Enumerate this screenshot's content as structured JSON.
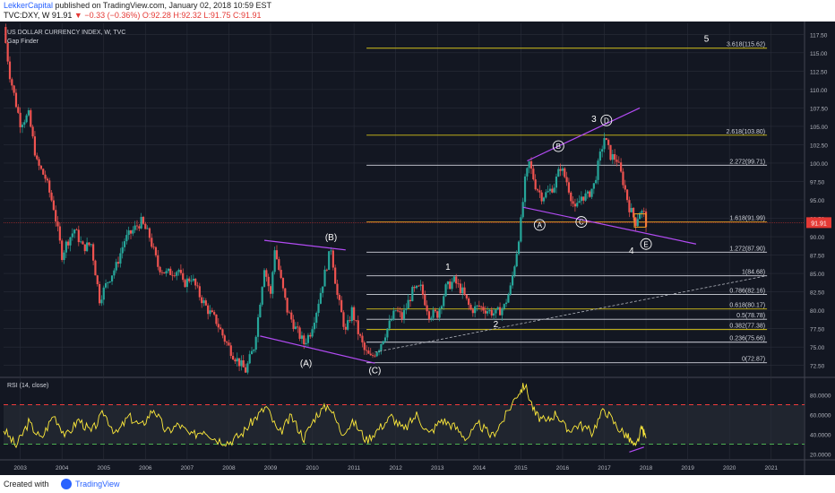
{
  "header": {
    "publisher": "LekkerCapital",
    "published_text": "published on TradingView.com, January 02, 2018 10:59 EST",
    "symbol_line_prefix": "TVC:DXY, W",
    "symbol_line_last": "91.91",
    "symbol_line_change": "▼ −0.33 (−0.36%)",
    "symbol_line_ohlc": "O:92.28 H:92.32 L:91.75 C:91.91"
  },
  "footer": {
    "created_with": "Created with",
    "brand": "TradingView"
  },
  "colors": {
    "background": "#131722",
    "grid": "#2a2e39",
    "axis_text": "#b2b5be",
    "up": "#26a69a",
    "down": "#ef5350",
    "fib_white": "#d1d4dc",
    "fib_yellow": "#d4c21a",
    "fib_orange": "#f5a623",
    "trendline": "#b24bf3",
    "rsi_line": "#ffeb3b",
    "rsi_over": "#ef3b3b",
    "rsi_under": "#4caf50",
    "price_line": "#e53935"
  },
  "chart_data": [
    {
      "type": "candlestick",
      "title": "US DOLLAR CURRENCY INDEX, W, TVC",
      "indicator": "Gap Finder",
      "x_tick_labels": [
        "2003",
        "2004",
        "2005",
        "2006",
        "2007",
        "2008",
        "2009",
        "2010",
        "2011",
        "2012",
        "2013",
        "2014",
        "2015",
        "2016",
        "2017",
        "2018",
        "2019",
        "2020",
        "2021"
      ],
      "xlim": [
        2002.6,
        2021.8
      ],
      "ylim": [
        71.0,
        119.0
      ],
      "y_tick_labels": [
        "117.50",
        "115.00",
        "112.50",
        "110.00",
        "107.50",
        "105.00",
        "102.50",
        "100.00",
        "97.50",
        "95.00",
        "92.50",
        "90.00",
        "87.50",
        "85.00",
        "82.50",
        "80.00",
        "77.50",
        "75.00",
        "72.50"
      ],
      "last_price_label": "91.91",
      "last_price": 91.91,
      "price_path": [
        [
          2002.6,
          118.5
        ],
        [
          2002.75,
          112
        ],
        [
          2002.9,
          108
        ],
        [
          2003.0,
          105.5
        ],
        [
          2003.2,
          106.5
        ],
        [
          2003.4,
          100
        ],
        [
          2003.6,
          98
        ],
        [
          2003.8,
          94
        ],
        [
          2004.0,
          87.5
        ],
        [
          2004.1,
          89
        ],
        [
          2004.3,
          91
        ],
        [
          2004.5,
          88.5
        ],
        [
          2004.7,
          89
        ],
        [
          2004.9,
          81.5
        ],
        [
          2005.1,
          84
        ],
        [
          2005.3,
          86
        ],
        [
          2005.5,
          89.5
        ],
        [
          2005.8,
          91.5
        ],
        [
          2005.9,
          92
        ],
        [
          2006.1,
          90
        ],
        [
          2006.3,
          86
        ],
        [
          2006.5,
          85
        ],
        [
          2006.8,
          85.5
        ],
        [
          2006.9,
          83.5
        ],
        [
          2007.1,
          84.5
        ],
        [
          2007.3,
          82
        ],
        [
          2007.5,
          80
        ],
        [
          2007.7,
          78.5
        ],
        [
          2007.9,
          76
        ],
        [
          2008.1,
          74
        ],
        [
          2008.3,
          72.5
        ],
        [
          2008.4,
          71.8
        ],
        [
          2008.6,
          75
        ],
        [
          2008.7,
          79
        ],
        [
          2008.85,
          86
        ],
        [
          2009.0,
          82
        ],
        [
          2009.1,
          88.5
        ],
        [
          2009.25,
          84
        ],
        [
          2009.4,
          80
        ],
        [
          2009.6,
          77.5
        ],
        [
          2009.8,
          75.5
        ],
        [
          2009.95,
          77
        ],
        [
          2010.1,
          80
        ],
        [
          2010.3,
          85
        ],
        [
          2010.45,
          88.5
        ],
        [
          2010.6,
          82
        ],
        [
          2010.8,
          77
        ],
        [
          2010.95,
          80
        ],
        [
          2011.1,
          77
        ],
        [
          2011.25,
          74.5
        ],
        [
          2011.4,
          73.5
        ],
        [
          2011.6,
          75
        ],
        [
          2011.8,
          77.5
        ],
        [
          2012.0,
          80
        ],
        [
          2012.15,
          79
        ],
        [
          2012.4,
          82.5
        ],
        [
          2012.6,
          83
        ],
        [
          2012.8,
          79.5
        ],
        [
          2013.0,
          79.5
        ],
        [
          2013.2,
          83
        ],
        [
          2013.4,
          84
        ],
        [
          2013.6,
          82.5
        ],
        [
          2013.8,
          80
        ],
        [
          2014.0,
          80.5
        ],
        [
          2014.2,
          80
        ],
        [
          2014.4,
          79.5
        ],
        [
          2014.6,
          80.5
        ],
        [
          2014.75,
          83
        ],
        [
          2014.9,
          88
        ],
        [
          2015.0,
          92
        ],
        [
          2015.1,
          97.5
        ],
        [
          2015.2,
          100
        ],
        [
          2015.35,
          97
        ],
        [
          2015.5,
          95.5
        ],
        [
          2015.65,
          96
        ],
        [
          2015.8,
          97
        ],
        [
          2015.95,
          99.5
        ],
        [
          2016.1,
          97.5
        ],
        [
          2016.3,
          93.5
        ],
        [
          2016.45,
          95.5
        ],
        [
          2016.6,
          95.5
        ],
        [
          2016.75,
          97
        ],
        [
          2016.9,
          101
        ],
        [
          2017.0,
          103.5
        ],
        [
          2017.15,
          101
        ],
        [
          2017.3,
          100.5
        ],
        [
          2017.45,
          97.5
        ],
        [
          2017.6,
          94
        ],
        [
          2017.75,
          92
        ],
        [
          2017.85,
          93.5
        ],
        [
          2017.95,
          93
        ],
        [
          2018.0,
          91.9
        ]
      ],
      "fib_levels": [
        {
          "label": "3.618(115.62)",
          "value": 115.62,
          "color": "yellow"
        },
        {
          "label": "2.618(103.80)",
          "value": 103.8,
          "color": "yellow"
        },
        {
          "label": "2.272(99.71)",
          "value": 99.71,
          "color": "white"
        },
        {
          "label": "1.618(91.99)",
          "value": 91.99,
          "color": "orange"
        },
        {
          "label": "1.272(87.90)",
          "value": 87.9,
          "color": "white"
        },
        {
          "label": "1(84.68)",
          "value": 84.68,
          "color": "white"
        },
        {
          "label": "0.786(82.16)",
          "value": 82.16,
          "color": "white"
        },
        {
          "label": "0.618(80.17)",
          "value": 80.17,
          "color": "yellow"
        },
        {
          "label": "0.5(78.78)",
          "value": 78.78,
          "color": "white"
        },
        {
          "label": "0.382(77.38)",
          "value": 77.38,
          "color": "yellow"
        },
        {
          "label": "0.236(75.66)",
          "value": 75.66,
          "color": "white"
        },
        {
          "label": "0(72.87)",
          "value": 72.87,
          "color": "white"
        }
      ],
      "fib_x_range": [
        2011.3,
        2020.9
      ],
      "trendlines": [
        {
          "from": [
            2008.85,
            89.5
          ],
          "to": [
            2010.8,
            88.2
          ]
        },
        {
          "from": [
            2008.75,
            76.5
          ],
          "to": [
            2011.5,
            72.8
          ]
        },
        {
          "from": [
            2015.05,
            94.0
          ],
          "to": [
            2019.2,
            89.0
          ]
        },
        {
          "from": [
            2015.15,
            100.3
          ],
          "to": [
            2017.85,
            107.5
          ]
        }
      ],
      "dashed_line": {
        "from": [
          2011.5,
          74.3
        ],
        "to": [
          2020.9,
          84.7
        ]
      },
      "wave_labels": [
        {
          "text": "(A)",
          "x": 2009.85,
          "y": 72.9,
          "circled": false
        },
        {
          "text": "(B)",
          "x": 2010.45,
          "y": 90.0,
          "circled": false
        },
        {
          "text": "(C)",
          "x": 2011.5,
          "y": 71.9,
          "circled": false
        },
        {
          "text": "1",
          "x": 2013.25,
          "y": 86.0,
          "circled": false
        },
        {
          "text": "2",
          "x": 2014.4,
          "y": 78.2,
          "circled": false
        },
        {
          "text": "A",
          "x": 2015.45,
          "y": 91.6,
          "circled": true
        },
        {
          "text": "B",
          "x": 2015.9,
          "y": 102.3,
          "circled": true
        },
        {
          "text": "C",
          "x": 2016.45,
          "y": 92.0,
          "circled": true
        },
        {
          "text": "3",
          "x": 2016.75,
          "y": 106.1,
          "circled": false
        },
        {
          "text": "D",
          "x": 2017.05,
          "y": 105.8,
          "circled": true
        },
        {
          "text": "4",
          "x": 2017.65,
          "y": 88.2,
          "circled": false
        },
        {
          "text": "E",
          "x": 2018.0,
          "y": 89.0,
          "circled": true
        },
        {
          "text": "5",
          "x": 2019.45,
          "y": 117.0,
          "circled": false
        }
      ]
    },
    {
      "type": "line",
      "title": "RSI (14, close)",
      "ylim": [
        15,
        95
      ],
      "y_tick_labels": [
        "80.0000",
        "60.0000",
        "40.0000",
        "20.0000"
      ],
      "y_tick_values": [
        80,
        60,
        40,
        20
      ],
      "overbought": 70,
      "oversold": 30,
      "band": [
        30,
        70
      ],
      "series": [
        {
          "x": [
            2002.6,
            2002.9,
            2003.2,
            2003.5,
            2003.8,
            2004.1,
            2004.4,
            2004.7,
            2005.0,
            2005.3,
            2005.6,
            2005.9,
            2006.2,
            2006.5,
            2006.8,
            2007.1,
            2007.4,
            2007.7,
            2008.0,
            2008.3,
            2008.6,
            2008.9,
            2009.2,
            2009.5,
            2009.8,
            2010.1,
            2010.4,
            2010.7,
            2011.0,
            2011.3,
            2011.6,
            2011.9,
            2012.2,
            2012.5,
            2012.8,
            2013.1,
            2013.4,
            2013.7,
            2014.0,
            2014.3,
            2014.6,
            2014.9,
            2015.1,
            2015.35,
            2015.6,
            2015.85,
            2016.1,
            2016.4,
            2016.7,
            2017.0,
            2017.3,
            2017.55,
            2017.75,
            2017.9,
            2018.0
          ],
          "values": [
            45,
            28,
            52,
            35,
            60,
            38,
            55,
            42,
            62,
            40,
            58,
            48,
            66,
            42,
            50,
            38,
            45,
            35,
            32,
            40,
            55,
            68,
            40,
            58,
            36,
            60,
            70,
            42,
            52,
            34,
            46,
            58,
            44,
            60,
            40,
            55,
            48,
            36,
            50,
            38,
            56,
            80,
            90,
            60,
            52,
            62,
            44,
            50,
            42,
            66,
            48,
            38,
            26,
            46,
            36
          ]
        }
      ]
    }
  ]
}
